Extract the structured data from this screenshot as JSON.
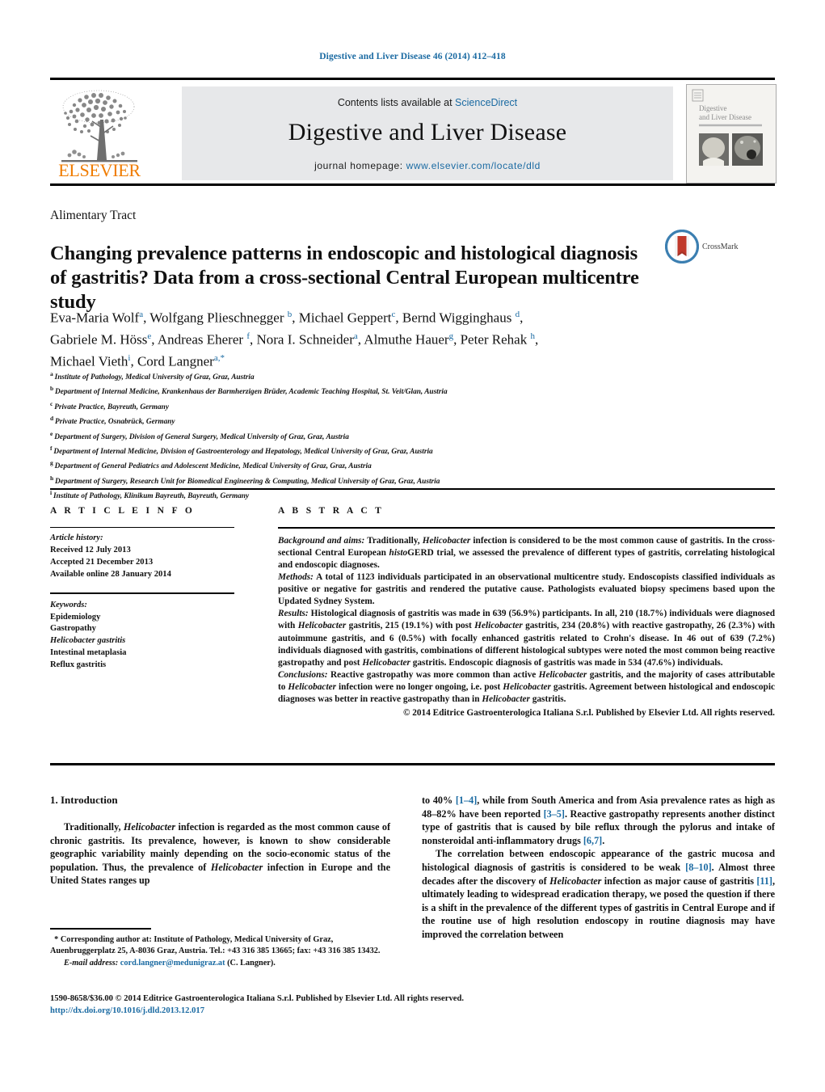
{
  "running_head": "Digestive and Liver Disease 46 (2014) 412–418",
  "masthead": {
    "contents_prefix": "Contents lists available at ",
    "sciencedirect": "ScienceDirect",
    "journal_title": "Digestive and Liver Disease",
    "homepage_prefix": "journal  homepage:  ",
    "homepage_url": "www.elsevier.com/locate/dld",
    "elsevier_wordmark": "ELSEVIER",
    "cover_title_line1": "Digestive",
    "cover_title_line2": "and Liver Disease",
    "link_color": "#1a6aa2",
    "box_color": "#e7e8ea",
    "elsevier_orange": "#f07c00"
  },
  "article": {
    "kicker": "Alimentary Tract",
    "title": "Changing prevalence patterns in endoscopic and histological diagnosis of gastritis? Data from a cross-sectional Central European multicentre study",
    "crossmark_label": "CrossMark",
    "authors_html": "Eva-Maria Wolf<sup>a</sup>, Wolfgang Plieschnegger <sup>b</sup>, Michael Geppert<sup>c</sup>, Bernd Wigginghaus <sup>d</sup>,<br>Gabriele M. Höss<sup>e</sup>, Andreas Eherer <sup>f</sup>, Nora I. Schneider<sup>a</sup>, Almuthe Hauer<sup>g</sup>, Peter Rehak <sup>h</sup>,<br>Michael Vieth<sup>i</sup>, Cord Langner<sup>a,</sup><sup>*</sup>",
    "affiliations": [
      {
        "mark": "a",
        "text": "Institute of Pathology, Medical University of Graz, Graz, Austria"
      },
      {
        "mark": "b",
        "text": "Department of Internal Medicine, Krankenhaus der Barmherzigen Brüder, Academic Teaching Hospital, St. Veit/Glan, Austria"
      },
      {
        "mark": "c",
        "text": "Private Practice, Bayreuth, Germany"
      },
      {
        "mark": "d",
        "text": "Private Practice, Osnabrück, Germany"
      },
      {
        "mark": "e",
        "text": "Department of Surgery, Division of General Surgery, Medical University of Graz, Graz, Austria"
      },
      {
        "mark": "f",
        "text": "Department of Internal Medicine, Division of Gastroenterology and Hepatology, Medical University of Graz, Graz, Austria"
      },
      {
        "mark": "g",
        "text": "Department of General Pediatrics and Adolescent Medicine, Medical University of Graz, Graz, Austria"
      },
      {
        "mark": "h",
        "text": "Department of Surgery, Research Unit for Biomedical Engineering & Computing, Medical University of Graz, Graz, Austria"
      },
      {
        "mark": "i",
        "text": "Institute of Pathology, Klinikum Bayreuth, Bayreuth, Germany"
      }
    ]
  },
  "article_info": {
    "heading": "A R T I C L E   I N F O",
    "history_label": "Article history:",
    "received": "Received 12 July 2013",
    "accepted": "Accepted 21 December 2013",
    "available": "Available online 28 January 2014",
    "keywords_label": "Keywords:",
    "keywords": [
      "Epidemiology",
      "Gastropathy",
      "Helicobacter gastritis",
      "Intestinal metaplasia",
      "Reflux gastritis"
    ]
  },
  "abstract": {
    "heading": "A B S T R A C T",
    "background_label": "Background and aims:",
    "background_text": " Traditionally, <i>Helicobacter</i> infection is considered to be the most common cause of gastritis. In the cross-sectional Central European <i>histo</i>GERD trial, we assessed the prevalence of different types of gastritis, correlating histological and endoscopic diagnoses.",
    "methods_label": "Methods:",
    "methods_text": " A total of 1123 individuals participated in an observational multicentre study. Endoscopists classified individuals as positive or negative for gastritis and rendered the putative cause. Pathologists evaluated biopsy specimens based upon the Updated Sydney System.",
    "results_label": "Results:",
    "results_text": " Histological diagnosis of gastritis was made in 639 (56.9%) participants. In all, 210 (18.7%) individuals were diagnosed with <i>Helicobacter</i> gastritis, 215 (19.1%) with post <i>Helicobacter</i> gastritis, 234 (20.8%) with reactive gastropathy, 26 (2.3%) with autoimmune gastritis, and 6 (0.5%) with focally enhanced gastritis related to Crohn's disease. In 46 out of 639 (7.2%) individuals diagnosed with gastritis, combinations of different histological subtypes were noted the most common being reactive gastropathy and post <i>Helicobacter</i> gastritis. Endoscopic diagnosis of gastritis was made in 534 (47.6%) individuals.",
    "conclusions_label": "Conclusions:",
    "conclusions_text": " Reactive gastropathy was more common than active <i>Helicobacter</i> gastritis, and the majority of cases attributable to <i>Helicobacter</i> infection were no longer ongoing, i.e. post <i>Helicobacter</i> gastritis. Agreement between histological and endoscopic diagnoses was better in reactive gastropathy than in <i>Helicobacter</i> gastritis.",
    "copyright": "© 2014 Editrice Gastroenterologica Italiana S.r.l. Published by Elsevier Ltd. All rights reserved."
  },
  "introduction": {
    "heading": "1.  Introduction",
    "para1_left": "Traditionally, <i>Helicobacter</i> infection is regarded as the most common cause of chronic gastritis. Its prevalence, however, is known to show considerable geographic variability mainly depending on the socio-economic status of the population. Thus, the prevalence of <i>Helicobacter</i> infection in Europe and the United States ranges up",
    "para1_right": "to 40% <span class=\"ref\">[1–4]</span>, while from South America and from Asia prevalence rates as high as 48–82% have been reported <span class=\"ref\">[3–5]</span>. Reactive gastropathy represents another distinct type of gastritis that is caused by bile reflux through the pylorus and intake of nonsteroidal anti-inflammatory drugs <span class=\"ref\">[6,7]</span>.",
    "para2_right": "The correlation between endoscopic appearance of the gastric mucosa and histological diagnosis of gastritis is considered to be weak <span class=\"ref\">[8–10]</span>. Almost three decades after the discovery of <i>Helicobacter</i> infection as major cause of gastritis <span class=\"ref\">[11]</span>, ultimately leading to widespread eradication therapy, we posed the question if there is a shift in the prevalence of the different types of gastritis in Central Europe and if the routine use of high resolution endoscopy in routine diagnosis may have improved the correlation between"
  },
  "footnote": {
    "corresponding": "Corresponding author at: Institute of Pathology, Medical University of Graz, Auenbruggerplatz 25, A-8036 Graz, Austria. Tel.: +43 316 385 13665; fax: +43 316 385 13432.",
    "email_label": "E-mail address:",
    "email": "cord.langner@medunigraz.at",
    "email_person": "(C. Langner)."
  },
  "imprint": {
    "line1": "1590-8658/$36.00 © 2014 Editrice Gastroenterologica Italiana S.r.l. Published by Elsevier Ltd. All rights reserved.",
    "doi": "http://dx.doi.org/10.1016/j.dld.2013.12.017"
  }
}
